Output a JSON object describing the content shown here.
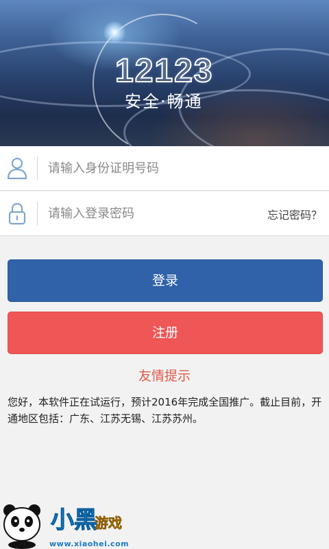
{
  "banner": {
    "logo_number": "12123",
    "slogan": "安全·畅通"
  },
  "form": {
    "id_placeholder": "请输入身份证明号码",
    "password_placeholder": "请输入登录密码",
    "forgot_password": "忘记密码？"
  },
  "buttons": {
    "login": "登录",
    "register": "注册"
  },
  "notice": {
    "title": "友情提示",
    "text": "您好，本软件正在试运行，预计2016年完成全国推广。截止目前，开通地区包括：广东、江苏无锡、江苏苏州。"
  },
  "watermark": {
    "brand_main": "小黑",
    "brand_sub": "游戏",
    "url": "www.xiaohei.com"
  },
  "colors": {
    "login_button": "#2f62a8",
    "register_button": "#ef5656",
    "tip_title": "#dd5a4a",
    "icon_color": "#7fa6cc"
  }
}
